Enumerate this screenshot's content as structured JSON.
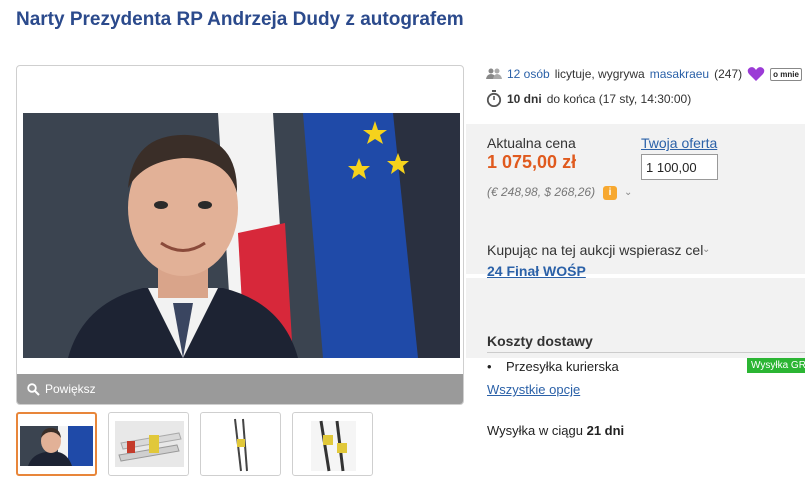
{
  "title": "Narty Prezydenta RP Andrzeja Dudy z autografem",
  "gallery": {
    "zoom_label": "Powiększ",
    "thumbnails": [
      "portrait",
      "skis-closeup",
      "skis-pair",
      "skis-bindings"
    ],
    "active_thumb": 0
  },
  "auction": {
    "bidders_count": "12 osób",
    "bidders_text": "licytuje, wygrywa",
    "winner": "masakraeu",
    "winner_rating": "(247)",
    "about_me": "o mnie",
    "days_left": "10 dni",
    "until_end_text": "do końca (17 sty, 14:30:00)"
  },
  "price": {
    "current_label": "Aktualna cena",
    "current_value": "1 075,00 zł",
    "converted": "(€ 248,98, $ 268,26)",
    "offer_label": "Twoja oferta",
    "offer_value": "1 100,00"
  },
  "cause": {
    "label": "Kupując na tej aukcji wspierasz cel",
    "name": "24 Finał WOŚP"
  },
  "shipping": {
    "heading": "Koszty dostawy",
    "item_bullet": "•",
    "item": "Przesyłka kurierska",
    "badge": "Wysyłka GR",
    "all_options": "Wszystkie opcje",
    "time_prefix": "Wysyłka w ciągu",
    "time_value": "21 dni"
  },
  "colors": {
    "title": "#2b4a8c",
    "link": "#2b61a8",
    "price": "#e05a1e",
    "badge_green": "#2bb533",
    "panel_bg": "#f2f2f2",
    "active_thumb_border": "#e8863a"
  },
  "icons": [
    "users-icon",
    "heart-icon",
    "stopwatch-icon",
    "info-icon",
    "chevron-down-icon",
    "magnifier-icon"
  ]
}
